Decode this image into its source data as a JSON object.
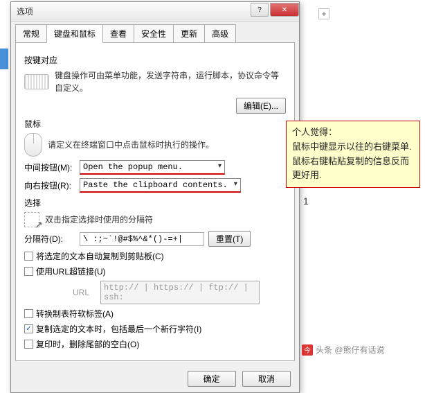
{
  "background": {
    "plus": "+",
    "num": "1"
  },
  "dialog_title": "选项",
  "tabs": [
    "常规",
    "键盘和鼠标",
    "查看",
    "安全性",
    "更新",
    "高级"
  ],
  "active_tab_index": 1,
  "keys": {
    "heading": "按键对应",
    "desc": "键盘操作可由菜单功能，发送字符串，运行脚本，协议命令等自定义。",
    "edit_btn": "编辑(E)..."
  },
  "mouse": {
    "heading": "鼠标",
    "desc": "请定义在终端窗口中点击鼠标时执行的操作。",
    "middle_label": "中间按钮(M):",
    "middle_value": "Open the popup menu.",
    "right_label": "向右按钮(R):",
    "right_value": "Paste the clipboard contents."
  },
  "selection": {
    "heading": "选择",
    "desc": "双击指定选择时使用的分隔符",
    "delim_label": "分隔符(D):",
    "delim_value": "\\ :;~`!@#$%^&*()-=+|",
    "reset_btn": "重置(T)",
    "cb_autocopy": "将选定的文本自动复制到剪贴板(C)",
    "cb_url": "使用URL超链接(U)",
    "url_label": "URL",
    "url_value": "http:// | https:// | ftp:// | ssh:",
    "cb_softtab": "转换制表符软标签(A)",
    "cb_copynl": "复制选定的文本时，包括最后一个新行字符(I)",
    "cb_trimws": "复印时，删除尾部的空白(O)"
  },
  "checked": {
    "autocopy": false,
    "url": false,
    "softtab": false,
    "copynl": true,
    "trimws": false
  },
  "buttons": {
    "ok": "确定",
    "cancel": "取消"
  },
  "annotation": "个人觉得：\n鼠标中键显示以往的右键菜单.\n鼠标右键粘贴复制的信息反而更好用.",
  "credit": "头条 @熊仔有话说"
}
